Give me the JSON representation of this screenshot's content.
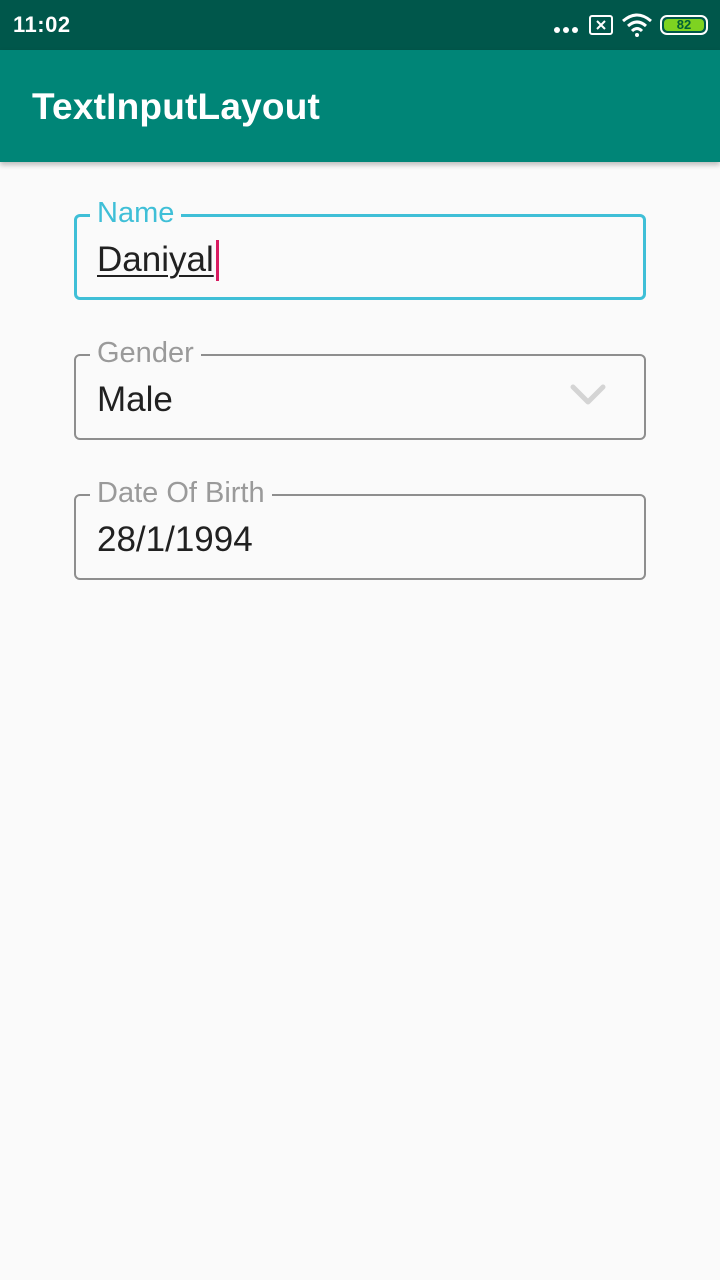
{
  "status_bar": {
    "time": "11:02",
    "battery_level": "82",
    "icons": [
      "more-dots-icon",
      "sim-icon",
      "wifi-icon",
      "battery-icon"
    ]
  },
  "app_bar": {
    "title": "TextInputLayout",
    "color": "#008577"
  },
  "form": {
    "name": {
      "label": "Name",
      "value": "Daniyal",
      "focused": true,
      "accent_color": "#3fbfd7"
    },
    "gender": {
      "label": "Gender",
      "value": "Male",
      "icon": "chevron-down-icon"
    },
    "dob": {
      "label": "Date Of Birth",
      "value": "28/1/1994"
    }
  }
}
